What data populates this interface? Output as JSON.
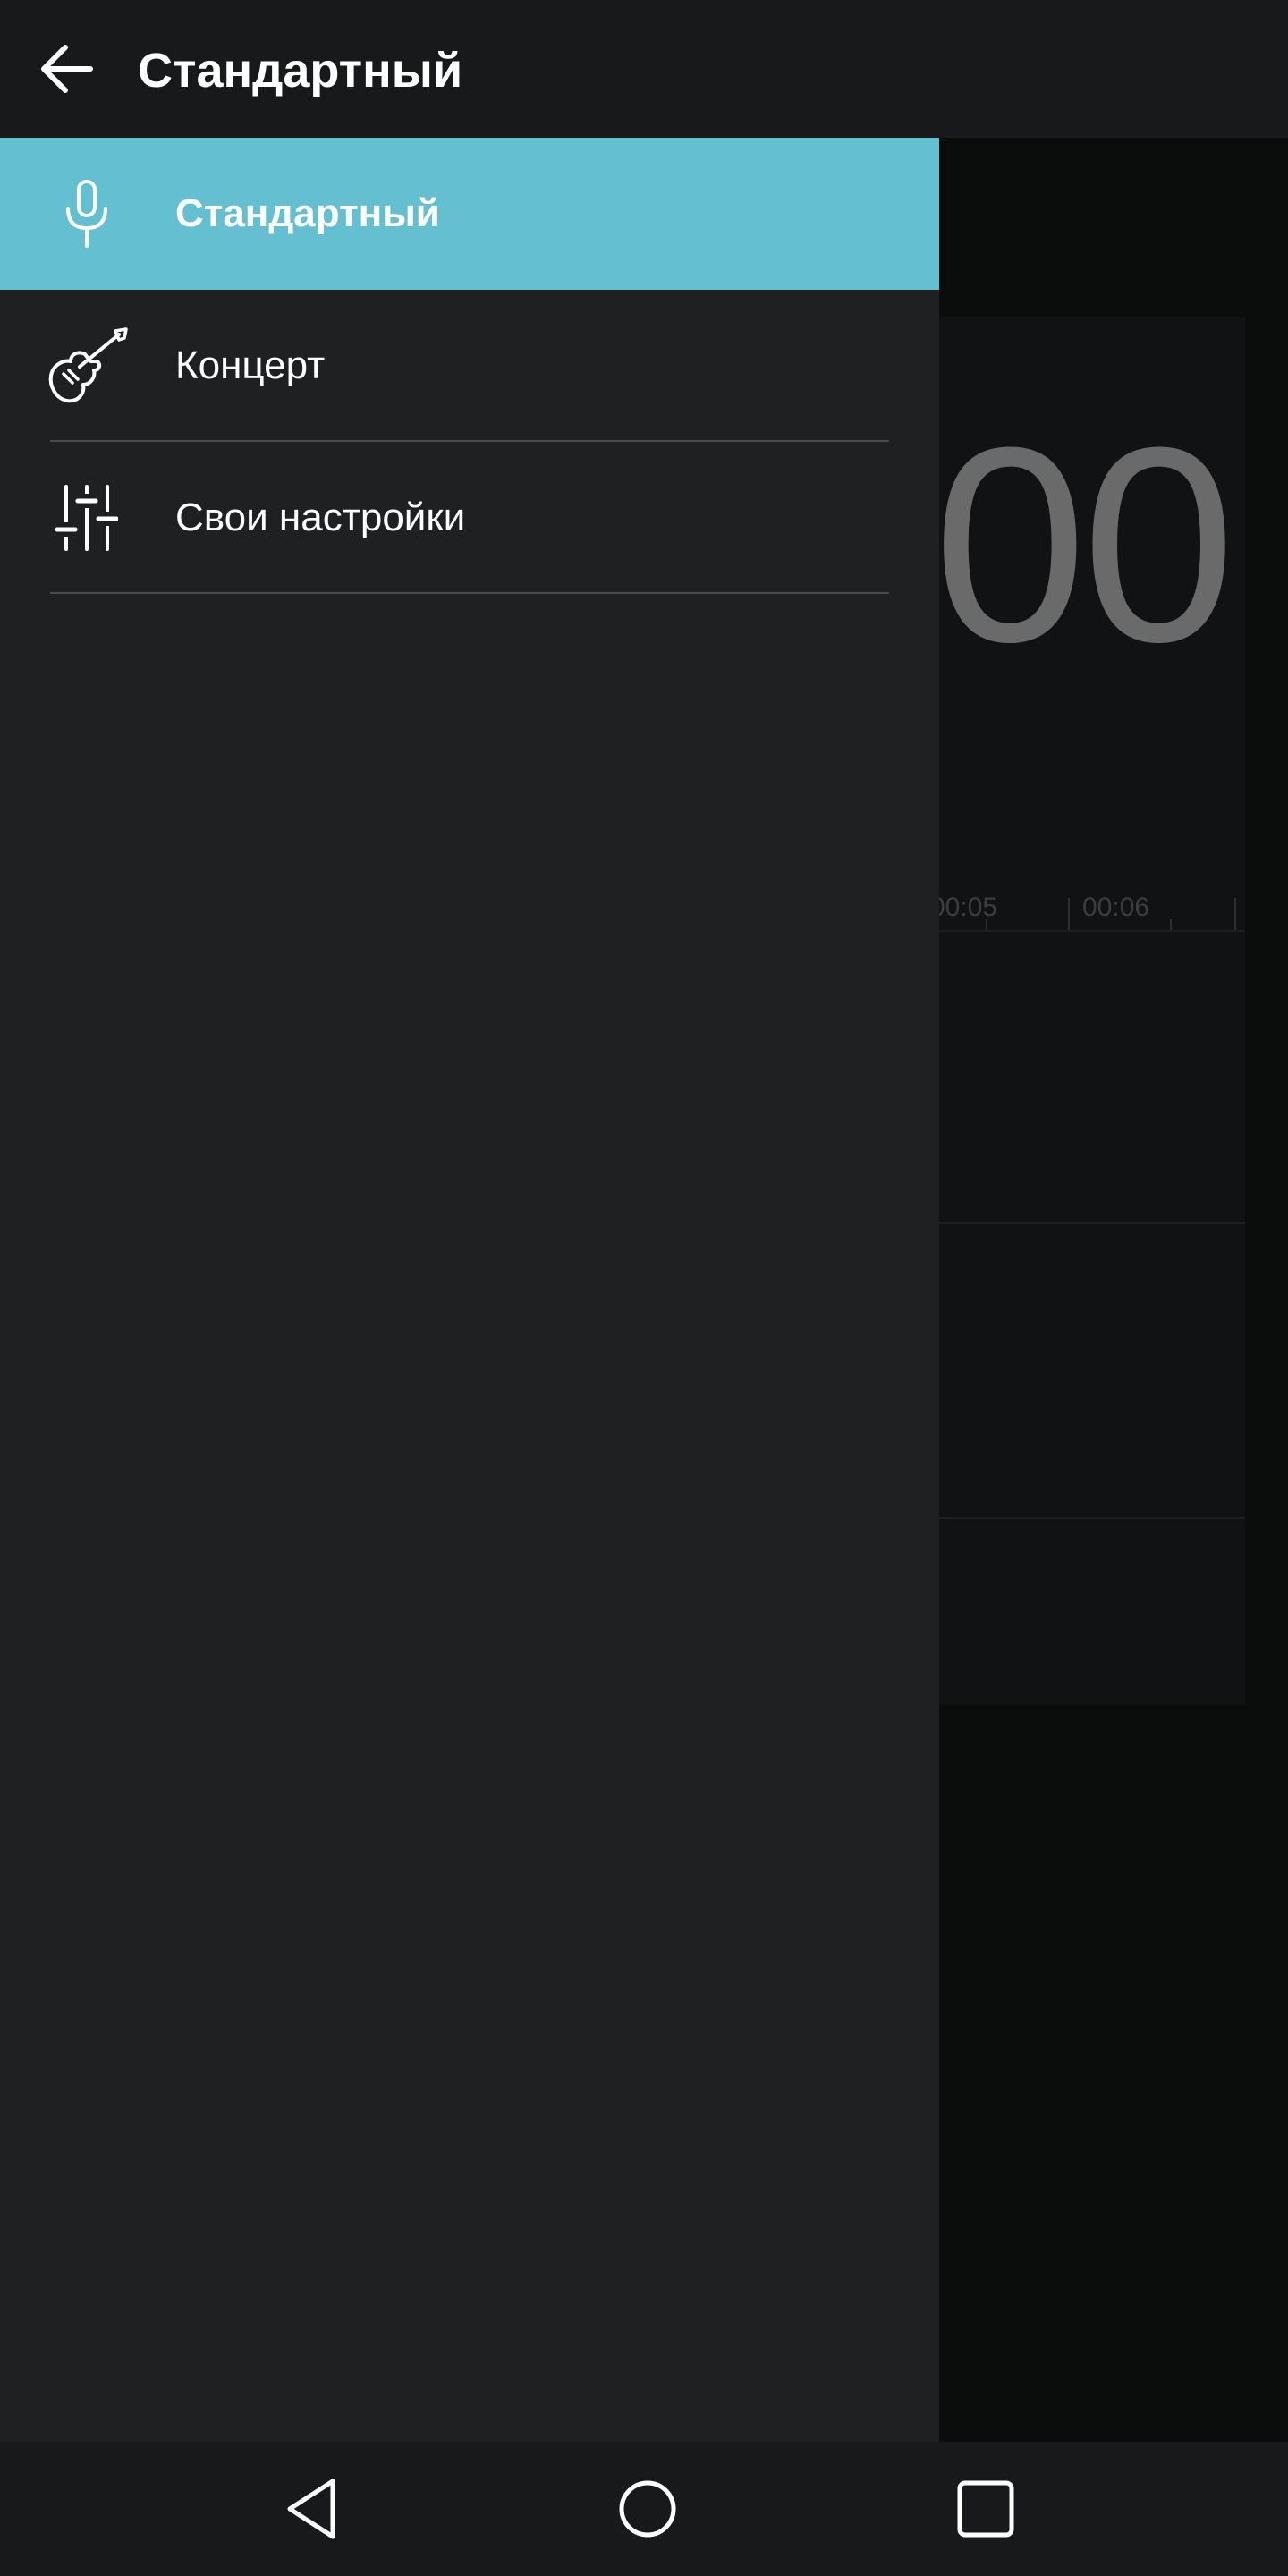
{
  "appbar": {
    "title": "Стандартный",
    "back_icon": "arrow-left-icon"
  },
  "drawer": {
    "items": [
      {
        "label": "Стандартный",
        "icon": "microphone-icon",
        "selected": true
      },
      {
        "label": "Концерт",
        "icon": "electric-guitar-icon",
        "selected": false
      },
      {
        "label": "Свои настройки",
        "icon": "sliders-icon",
        "selected": false
      }
    ],
    "selected_color": "#64c0d0"
  },
  "background": {
    "timer_fragment": "00",
    "timeline_labels": [
      "00:05",
      "00:06"
    ]
  },
  "navbar": {
    "back_icon": "triangle-back-icon",
    "home_icon": "circle-home-icon",
    "recents_icon": "square-recents-icon"
  }
}
